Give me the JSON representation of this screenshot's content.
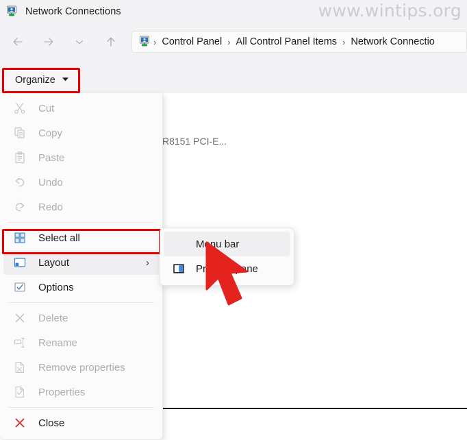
{
  "window": {
    "title": "Network Connections",
    "app_icon": "network-connections-icon"
  },
  "watermark": {
    "text": "www.wintips.org"
  },
  "navigation": {
    "back_icon": "arrow-left-icon",
    "forward_icon": "arrow-right-icon",
    "recent_icon": "chevron-down-icon",
    "up_icon": "arrow-up-icon"
  },
  "addressbar": {
    "icon": "network-connections-icon",
    "separator": "›",
    "crumbs": [
      "Control Panel",
      "All Control Panel Items",
      "Network Connectio"
    ]
  },
  "toolbar": {
    "organize_label": "Organize",
    "organize_caret": "chevron-down-icon",
    "highlight_color": "#e60000"
  },
  "content": {
    "nic_label": "R8151 PCI-E..."
  },
  "organize_menu": {
    "items": [
      {
        "label": "Cut",
        "icon": "scissors-icon",
        "enabled": false,
        "submenu": false
      },
      {
        "label": "Copy",
        "icon": "copy-icon",
        "enabled": false,
        "submenu": false
      },
      {
        "label": "Paste",
        "icon": "clipboard-icon",
        "enabled": false,
        "submenu": false
      },
      {
        "label": "Undo",
        "icon": "undo-arrow-icon",
        "enabled": false,
        "submenu": false
      },
      {
        "label": "Redo",
        "icon": "redo-arrow-icon",
        "enabled": false,
        "submenu": false
      },
      {
        "label": "Select all",
        "icon": "select-all-grid-icon",
        "enabled": true,
        "submenu": false
      },
      {
        "label": "Layout",
        "icon": "layout-pane-icon",
        "enabled": true,
        "submenu": true
      },
      {
        "label": "Options",
        "icon": "options-checkbox-icon",
        "enabled": true,
        "submenu": false
      },
      {
        "label": "Delete",
        "icon": "delete-x-icon",
        "enabled": false,
        "submenu": false
      },
      {
        "label": "Rename",
        "icon": "rename-icon",
        "enabled": false,
        "submenu": false
      },
      {
        "label": "Remove properties",
        "icon": "remove-properties-icon",
        "enabled": false,
        "submenu": false
      },
      {
        "label": "Properties",
        "icon": "properties-icon",
        "enabled": false,
        "submenu": false
      },
      {
        "label": "Close",
        "icon": "close-x-red-icon",
        "enabled": true,
        "submenu": false
      }
    ],
    "submenu_arrow": "›"
  },
  "layout_submenu": {
    "items": [
      {
        "label": "Menu bar",
        "icon": "menu-bar-icon",
        "highlighted": true
      },
      {
        "label": "Preview pane",
        "icon": "preview-pane-icon",
        "highlighted": false
      }
    ]
  },
  "cursor": {
    "icon": "mouse-pointer-red-icon",
    "color": "#e4231f"
  }
}
